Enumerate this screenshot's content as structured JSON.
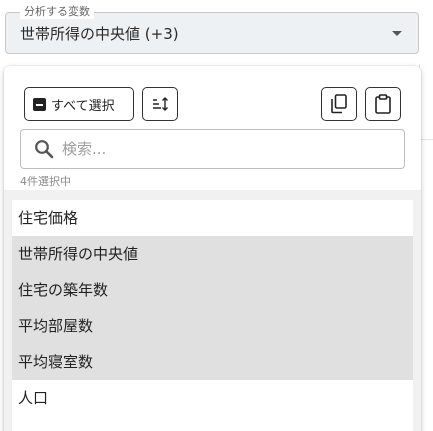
{
  "select": {
    "legend": "分析する変数",
    "value": "世帯所得の中央値 (+3)"
  },
  "toolbar": {
    "select_all_label": "すべて選択",
    "sort_icon": "sort-icon",
    "copy_icon": "copy-icon",
    "paste_icon": "clipboard-icon"
  },
  "search": {
    "placeholder": "検索..."
  },
  "status": {
    "selected_count": "4件選択中"
  },
  "list": {
    "items": [
      {
        "label": "住宅価格",
        "selected": false
      },
      {
        "label": "世帯所得の中央値",
        "selected": true
      },
      {
        "label": "住宅の築年数",
        "selected": true
      },
      {
        "label": "平均部屋数",
        "selected": true
      },
      {
        "label": "平均寝室数",
        "selected": true
      },
      {
        "label": "人口",
        "selected": false
      }
    ]
  },
  "colors": {
    "selected_row": "#e0e0e0",
    "field_bg": "#eef1f4"
  }
}
